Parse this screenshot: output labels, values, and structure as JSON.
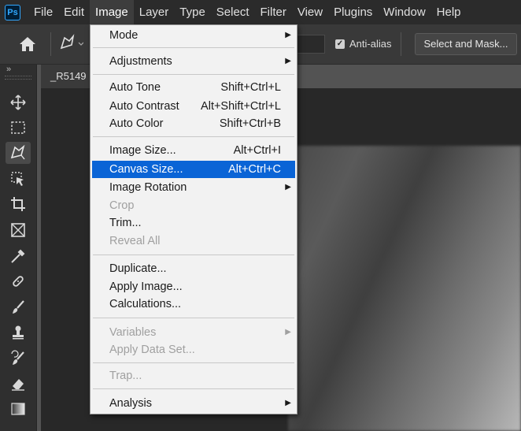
{
  "app": {
    "logo_text": "Ps",
    "menubar": [
      "File",
      "Edit",
      "Image",
      "Layer",
      "Type",
      "Select",
      "Filter",
      "View",
      "Plugins",
      "Window",
      "Help"
    ],
    "active_menu": "Image"
  },
  "options": {
    "anti_alias_label": "Anti-alias",
    "anti_alias_checked": true,
    "select_and_mask_label": "Select and Mask..."
  },
  "toolbar": {
    "collapse": "»",
    "tools": [
      "move-icon",
      "marquee-icon",
      "polygonal-lasso-icon",
      "object-select-icon",
      "crop-icon",
      "frame-icon",
      "eyedropper-icon",
      "healing-brush-icon",
      "brush-icon",
      "clone-stamp-icon",
      "history-brush-icon",
      "eraser-icon",
      "gradient-icon"
    ]
  },
  "document": {
    "tab_title": "_R5149"
  },
  "image_menu": {
    "mode": "Mode",
    "adjustments": "Adjustments",
    "auto_tone": "Auto Tone",
    "auto_tone_sc": "Shift+Ctrl+L",
    "auto_contrast": "Auto Contrast",
    "auto_contrast_sc": "Alt+Shift+Ctrl+L",
    "auto_color": "Auto Color",
    "auto_color_sc": "Shift+Ctrl+B",
    "image_size": "Image Size...",
    "image_size_sc": "Alt+Ctrl+I",
    "canvas_size": "Canvas Size...",
    "canvas_size_sc": "Alt+Ctrl+C",
    "image_rotation": "Image Rotation",
    "crop": "Crop",
    "trim": "Trim...",
    "reveal_all": "Reveal All",
    "duplicate": "Duplicate...",
    "apply_image": "Apply Image...",
    "calculations": "Calculations...",
    "variables": "Variables",
    "apply_data_set": "Apply Data Set...",
    "trap": "Trap...",
    "analysis": "Analysis",
    "highlighted": "Canvas Size..."
  },
  "colors": {
    "highlight": "#0a64d6",
    "menubar_bg": "#2b2b2b",
    "menu_bg": "#f2f2f2"
  }
}
